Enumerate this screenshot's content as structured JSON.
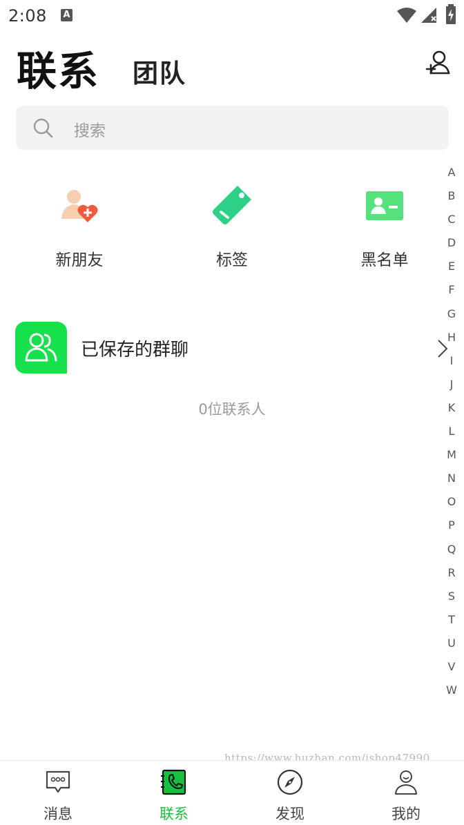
{
  "status_bar": {
    "time": "2:08",
    "badge": "A"
  },
  "header": {
    "title": "联系",
    "team_tab": "团队"
  },
  "search": {
    "placeholder": "搜索"
  },
  "features": [
    {
      "label": "新朋友",
      "icon": "new-friend-icon"
    },
    {
      "label": "标签",
      "icon": "tag-icon"
    },
    {
      "label": "黑名单",
      "icon": "blacklist-icon"
    }
  ],
  "saved_groups": {
    "label": "已保存的群聊"
  },
  "contact_count": "0位联系人",
  "alpha_index": [
    "A",
    "B",
    "C",
    "D",
    "E",
    "F",
    "G",
    "H",
    "I",
    "J",
    "K",
    "L",
    "M",
    "N",
    "O",
    "P",
    "Q",
    "R",
    "S",
    "T",
    "U",
    "V",
    "W"
  ],
  "watermark": "https://www.huzhan.com/ishop47990",
  "tabbar": [
    {
      "label": "消息",
      "icon": "message-icon"
    },
    {
      "label": "联系",
      "icon": "contacts-phone-icon",
      "active": true
    },
    {
      "label": "发现",
      "icon": "compass-icon"
    },
    {
      "label": "我的",
      "icon": "profile-icon"
    }
  ],
  "colors": {
    "accent": "#17c13f",
    "group_icon_bg": "#17e04d",
    "tag": "#2ecf86",
    "blacklist": "#55e27c",
    "new_friend_heart": "#f25a3d"
  }
}
